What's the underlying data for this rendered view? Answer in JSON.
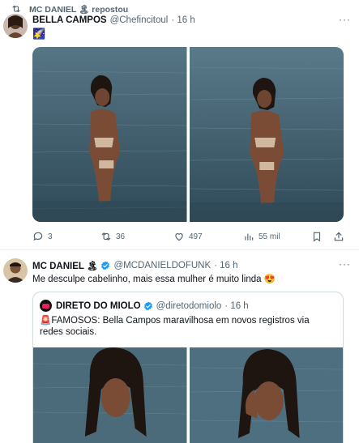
{
  "repost": {
    "text": "MC DANIEL 🏝 repostou"
  },
  "post1": {
    "name": "BELLA CAMPOS",
    "handle": "@Chefincitoul",
    "time": "· 16 h",
    "body": "🌠",
    "actions": {
      "replies": "3",
      "reposts": "36",
      "likes": "497",
      "views": "55 mil"
    }
  },
  "post2": {
    "name": "MC DANIEL 🏝",
    "handle": "@MCDANIELDOFUNK",
    "time": "· 16 h",
    "body": "Me desculpe cabelinho, mais essa mulher é muito linda 😍",
    "quote": {
      "name": "DIRETO DO MIOLO",
      "handle": "@diretodomiolo",
      "time": "· 16 h",
      "body": "🚨FAMOSOS: Bella Campos maravilhosa em novos registros via redes sociais."
    }
  },
  "colors": {
    "accent": "#1d9bf0",
    "muted": "#536471",
    "water": "#3e5a6a"
  }
}
